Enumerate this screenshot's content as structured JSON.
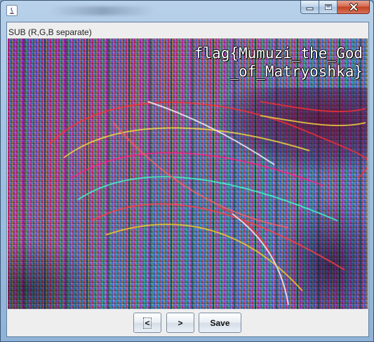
{
  "window": {
    "title": "",
    "controls": {
      "minimize": "minimize",
      "maximize": "maximize",
      "close": "close"
    }
  },
  "image_label": "SUB (R,G,B separate)",
  "image": {
    "flag_line_1": "flag{Mumuzi_the_God",
    "flag_line_2": "_of_Matryoshka}"
  },
  "buttons": {
    "prev_label": "<",
    "next_label": ">",
    "save_label": "Save"
  },
  "colors": {
    "titlebar": "#a6c4e3",
    "close_button": "#c2421f",
    "client_background": "#eeeeee",
    "flag_text": "#ffffff"
  }
}
